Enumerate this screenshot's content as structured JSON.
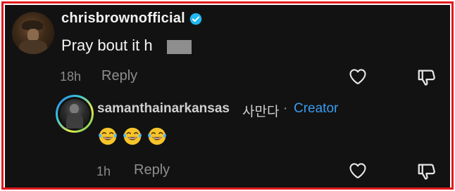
{
  "comment": {
    "username": "chrisbrownofficial",
    "text": "Pray bout it h",
    "time": "18h",
    "reply_label": "Reply"
  },
  "reply": {
    "username": "samanthainarkansas",
    "extra": "사만다",
    "separator": "·",
    "badge": "Creator",
    "emojis": [
      "😂",
      "😂",
      "😂"
    ],
    "time": "1h",
    "reply_label": "Reply"
  },
  "colors": {
    "background": "#121212",
    "frame_border": "#e0191c",
    "verified": "#20b8f0",
    "creator": "#3a9bf0",
    "muted": "#8a8a8a"
  },
  "icons": {
    "verified": "verified-badge-icon",
    "like": "heart-icon",
    "dislike": "thumbs-down-icon"
  }
}
